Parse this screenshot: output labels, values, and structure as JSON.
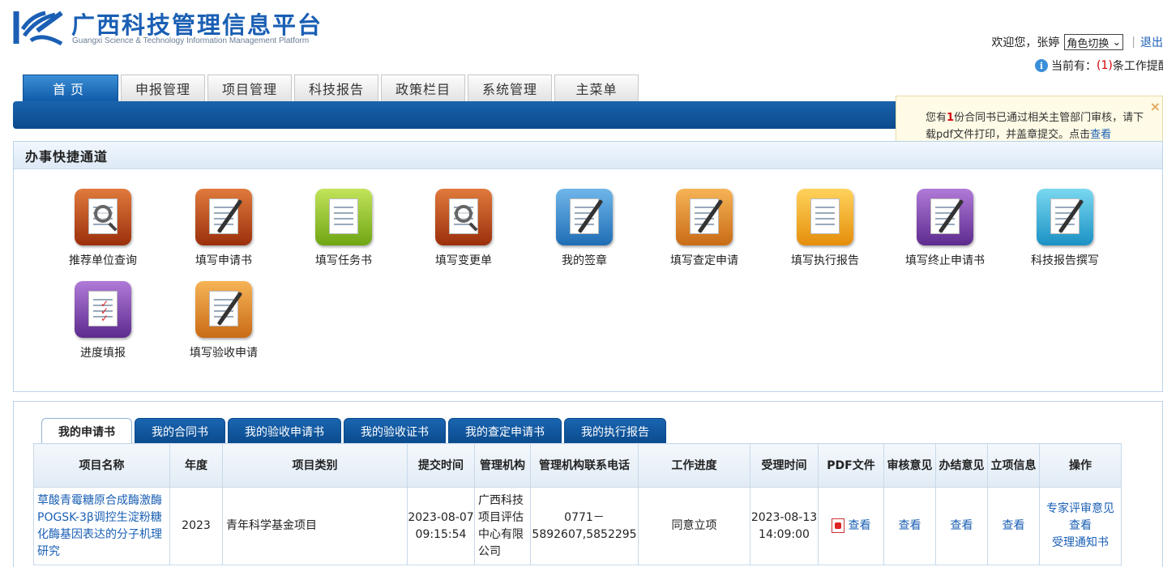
{
  "header": {
    "logo_cn": "广西科技管理信息平台",
    "logo_en": "Guangxi Science & Technology Information Management Platform",
    "welcome": "欢迎您，张婷",
    "role_switch": "角色切换",
    "logout": "退出",
    "notice_prefix": "当前有：",
    "notice_count": "(1)",
    "notice_suffix": "条工作提醒"
  },
  "nav": {
    "tabs": [
      "首页",
      "申报管理",
      "项目管理",
      "科技报告",
      "政策栏目",
      "系统管理",
      "主菜单"
    ],
    "active_index": 0
  },
  "popup": {
    "text_a": "您有",
    "count": "1",
    "text_b": "份合同书已通过相关主管部门审核，请下载pdf文件打印，并盖章提交。点击",
    "link": "查看",
    "close": "×"
  },
  "quick": {
    "title": "办事快捷通道",
    "items": [
      {
        "label": "推荐单位查询",
        "icon": "magnifier-doc-icon",
        "bg": "brown"
      },
      {
        "label": "填写申请书",
        "icon": "form-pen-icon",
        "bg": "brown"
      },
      {
        "label": "填写任务书",
        "icon": "stacked-docs-icon",
        "bg": "green"
      },
      {
        "label": "填写变更单",
        "icon": "magnifier-doc-icon",
        "bg": "brown"
      },
      {
        "label": "我的签章",
        "icon": "doc-pen-icon",
        "bg": "blue"
      },
      {
        "label": "填写查定申请",
        "icon": "clipboard-pen-icon",
        "bg": "orange"
      },
      {
        "label": "填写执行报告",
        "icon": "stacked-docs-icon",
        "bg": "gold"
      },
      {
        "label": "填写终止申请书",
        "icon": "doc-pen-icon",
        "bg": "purple"
      },
      {
        "label": "科技报告撰写",
        "icon": "doc-pen-icon",
        "bg": "cyan"
      },
      {
        "label": "进度填报",
        "icon": "checklist-icon",
        "bg": "purple"
      },
      {
        "label": "填写验收申请",
        "icon": "clipboard-pen-icon",
        "bg": "orange"
      }
    ]
  },
  "lower": {
    "tabs": [
      "我的申请书",
      "我的合同书",
      "我的验收申请书",
      "我的验收证书",
      "我的查定申请书",
      "我的执行报告"
    ],
    "active_index": 0,
    "columns": [
      "项目名称",
      "年度",
      "项目类别",
      "提交时间",
      "管理机构",
      "管理机构联系电话",
      "工作进度",
      "受理时间",
      "PDF文件",
      "审核意见",
      "办结意见",
      "立项信息",
      "操作"
    ],
    "rows": [
      {
        "name": "草酸青霉糖原合成酶激酶POGSK-3β调控生淀粉糖化酶基因表达的分子机理研究",
        "year": "2023",
        "category": "青年科学基金项目",
        "submit_time": "2023-08-07 09:15:54",
        "org": "广西科技项目评估中心有限公司",
        "phone": "0771－5892607,5852295",
        "progress": "同意立项",
        "accept_time": "2023-08-13 14:09:00",
        "pdf": "查看",
        "review": "查看",
        "conclusion": "查看",
        "approval": "查看",
        "op1": "专家评审意见",
        "op2": "查看",
        "op3": "受理通知书"
      }
    ]
  },
  "colors": {
    "brand": "#1a5fb4",
    "nav_bar": "#0a4a8c",
    "alert": "#d40000"
  }
}
